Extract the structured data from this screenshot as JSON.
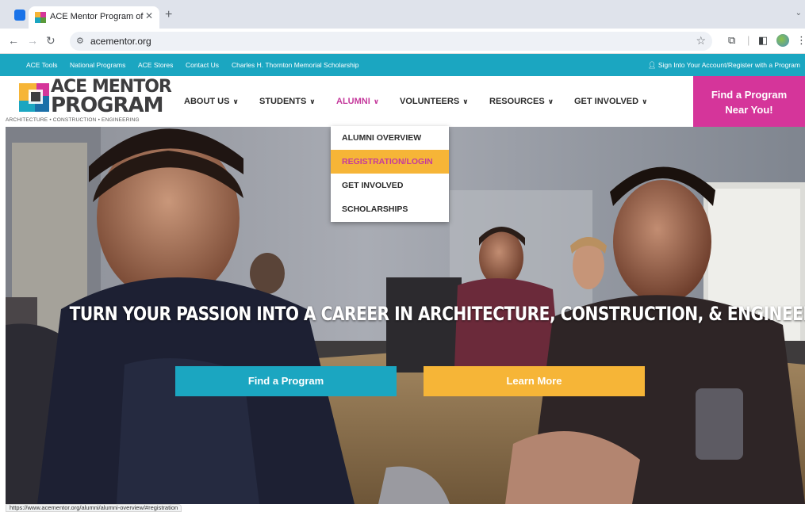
{
  "browser": {
    "tab_title": "ACE Mentor Program of Amer",
    "tab_close": "✕",
    "new_tab": "+",
    "url": "acementor.org",
    "status_url": "https://www.acementor.org/alumni/alumni-overview/#registration",
    "icons": [
      "back-icon",
      "forward-icon",
      "reload-icon",
      "site-settings-icon",
      "bookmark-star-icon",
      "extensions-icon",
      "side-panel-icon",
      "profile-icon",
      "menu-icon"
    ]
  },
  "utility": {
    "links": [
      "ACE Tools",
      "National Programs",
      "ACE Stores",
      "Contact Us",
      "Charles H. Thornton Memorial Scholarship"
    ],
    "signin": "Sign Into Your Account/Register with a Program"
  },
  "logo": {
    "line1": "ACE MENTOR",
    "line2": "PROGRAM",
    "tagline": "ARCHITECTURE • CONSTRUCTION • ENGINEERING"
  },
  "nav": {
    "items": [
      {
        "label": "ABOUT US"
      },
      {
        "label": "STUDENTS"
      },
      {
        "label": "ALUMNI"
      },
      {
        "label": "VOLUNTEERS"
      },
      {
        "label": "RESOURCES"
      },
      {
        "label": "GET INVOLVED"
      }
    ],
    "active": "ALUMNI"
  },
  "cta": {
    "line1": "Find a Program",
    "line2": "Near You!"
  },
  "dropdown": {
    "items": [
      {
        "label": "ALUMNI OVERVIEW"
      },
      {
        "label": "REGISTRATION/LOGIN"
      },
      {
        "label": "GET INVOLVED"
      },
      {
        "label": "SCHOLARSHIPS"
      }
    ],
    "hovered": "REGISTRATION/LOGIN"
  },
  "hero": {
    "headline": "TURN YOUR PASSION INTO A CAREER IN ARCHITECTURE, CONSTRUCTION, & ENGINEERING",
    "buttons": {
      "find": "Find a Program",
      "learn": "Learn More"
    }
  },
  "colors": {
    "teal": "#1ba6c1",
    "magenta": "#d5359a",
    "gold": "#f6b537",
    "active_nav": "#c53a9c"
  }
}
